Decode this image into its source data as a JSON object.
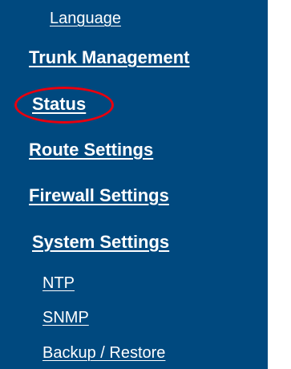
{
  "menu": {
    "items": [
      {
        "label": "Language",
        "level": "sub"
      },
      {
        "label": "Trunk Management",
        "level": "main"
      },
      {
        "label": "Status",
        "level": "main",
        "highlighted": true
      },
      {
        "label": "Route Settings",
        "level": "main"
      },
      {
        "label": "Firewall Settings",
        "level": "main"
      },
      {
        "label": "System Settings",
        "level": "main"
      },
      {
        "label": "NTP",
        "level": "sub"
      },
      {
        "label": "SNMP",
        "level": "sub"
      },
      {
        "label": "Backup / Restore",
        "level": "sub"
      }
    ]
  },
  "colors": {
    "panel_background": "#00497f",
    "text": "#ffffff",
    "highlight_circle": "#e8000f"
  }
}
